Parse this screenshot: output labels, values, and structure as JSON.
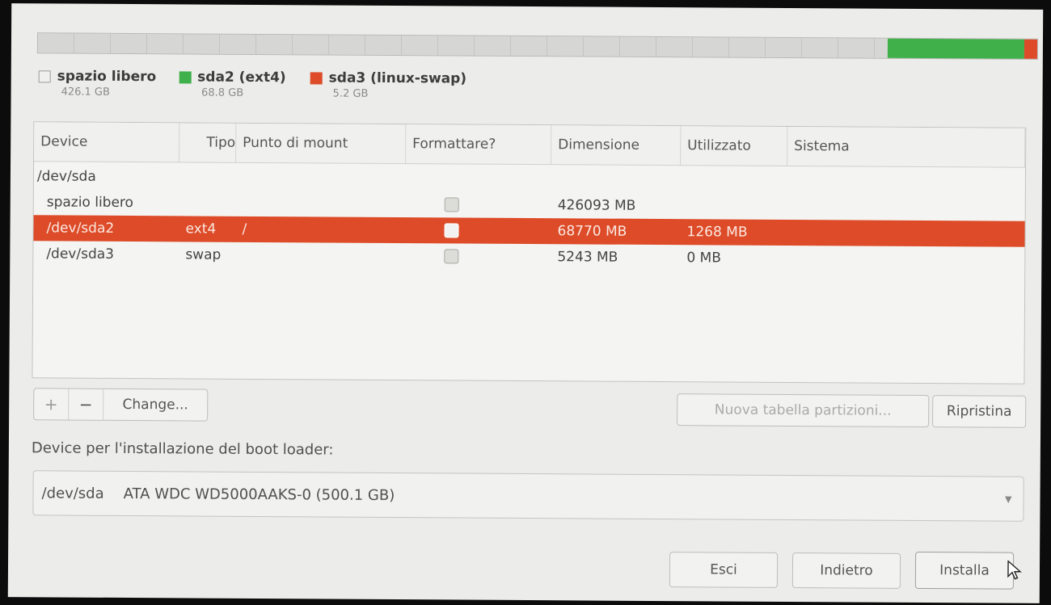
{
  "disk_bar": {
    "segments": [
      {
        "name": "spazio libero",
        "fraction": 0.85,
        "color": "#d4d4d2"
      },
      {
        "name": "sda2",
        "fraction": 0.137,
        "color": "#3fb04a"
      },
      {
        "name": "sda3",
        "fraction": 0.013,
        "color": "#dd4b28"
      }
    ]
  },
  "legend": [
    {
      "name": "spazio libero",
      "size": "426.1 GB",
      "color": "#f0f0ee"
    },
    {
      "name": "sda2 (ext4)",
      "size": "68.8 GB",
      "color": "#3fb04a"
    },
    {
      "name": "sda3 (linux-swap)",
      "size": "5.2 GB",
      "color": "#dd4b28"
    }
  ],
  "table": {
    "columns": [
      "Device",
      "Tipo",
      "Punto di mount",
      "Formattare?",
      "Dimensione",
      "Utilizzato",
      "Sistema"
    ],
    "rows": [
      {
        "device": "/dev/sda",
        "tipo": "",
        "mount": "",
        "format": null,
        "size": "",
        "used": "",
        "system": "",
        "selected": false
      },
      {
        "device": "spazio libero",
        "tipo": "",
        "mount": "",
        "format": false,
        "size": "426093 MB",
        "used": "",
        "system": "",
        "selected": false
      },
      {
        "device": "/dev/sda2",
        "tipo": "ext4",
        "mount": "/",
        "format": false,
        "size": "68770 MB",
        "used": "1268 MB",
        "system": "",
        "selected": true
      },
      {
        "device": "/dev/sda3",
        "tipo": "swap",
        "mount": "",
        "format": false,
        "size": "5243 MB",
        "used": "0 MB",
        "system": "",
        "selected": false
      }
    ]
  },
  "toolbar": {
    "add_label": "+",
    "remove_label": "−",
    "change_label": "Change...",
    "new_table_label": "Nuova tabella partizioni...",
    "revert_label": "Ripristina"
  },
  "bootloader": {
    "label": "Device per l'installazione del boot loader:",
    "device": "/dev/sda",
    "description": "ATA WDC WD5000AAKS-0 (500.1 GB)"
  },
  "footer": {
    "quit_label": "Esci",
    "back_label": "Indietro",
    "install_label": "Installa"
  }
}
